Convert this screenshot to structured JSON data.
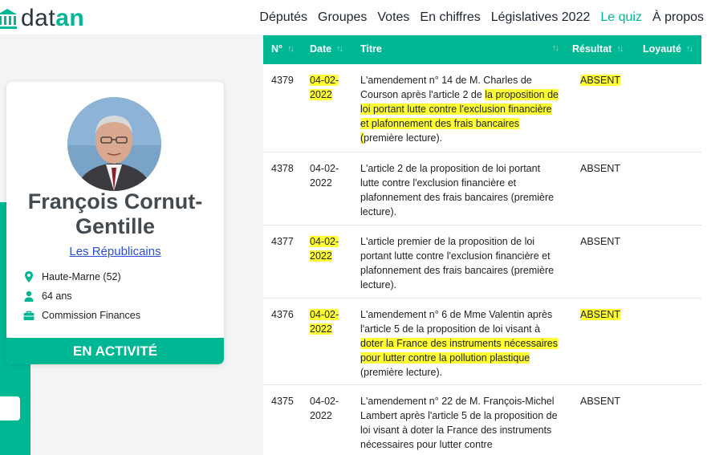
{
  "nav": {
    "logo_prefix": "dat",
    "logo_accent": "an",
    "items": [
      "Députés",
      "Groupes",
      "Votes",
      "En chiffres",
      "Législatives 2022",
      "Le quiz",
      "À propos"
    ]
  },
  "profile": {
    "name_line1": "François Cornut-",
    "name_line2": "Gentille",
    "party": "Les Républicains",
    "location": "Haute-Marne (52)",
    "age": "64 ans",
    "commission": "Commission Finances",
    "status": "EN ACTIVITÉ"
  },
  "table": {
    "headers": {
      "num": "N°",
      "date": "Date",
      "title": "Titre",
      "result": "Résultat",
      "loyalty": "Loyauté"
    },
    "rows": [
      {
        "num": "4379",
        "date": "04-02-2022",
        "title_plain": "L'amendement n° 14 de M. Charles de Courson après l'article 2 de ",
        "title_hl": "la proposition de loi portant lutte contre l'exclusion financière et plafonnement des frais bancaires (",
        "title_end": "première lecture).",
        "result": "ABSENT",
        "highlight": true
      },
      {
        "num": "4378",
        "date": "04-02-2022",
        "title_plain": "L'article 2 de la proposition de loi portant lutte contre l'exclusion financière et plafonnement des frais bancaires (première lecture).",
        "title_hl": "",
        "title_end": "",
        "result": "ABSENT",
        "highlight": false
      },
      {
        "num": "4377",
        "date": "04-02-2022",
        "title_plain": "L'article premier de la proposition de loi portant lutte contre l'exclusion financière et plafonnement des frais bancaires (première lecture).",
        "title_hl": "",
        "title_end": "",
        "result": "ABSENT",
        "highlight": "date"
      },
      {
        "num": "4376",
        "date": "04-02-2022",
        "title_plain": "L'amendement n° 6 de Mme Valentin après l'article 5 de la proposition de loi visant à ",
        "title_hl": "doter la France des instruments nécessaires pour lutter contre la pollution plastique",
        "title_end": " (première lecture).",
        "result": "ABSENT",
        "highlight": true
      },
      {
        "num": "4375",
        "date": "04-02-2022",
        "title_plain": "L'amendement n° 22 de M. François-Michel Lambert après l'article 5 de la proposition de loi visant à doter la France des instruments nécessaires pour lutter contre",
        "title_hl": "",
        "title_end": "",
        "result": "ABSENT",
        "highlight": false
      }
    ]
  },
  "colors": {
    "accent": "#00b794",
    "highlight": "#ffff33",
    "link": "#2d4fd6"
  }
}
